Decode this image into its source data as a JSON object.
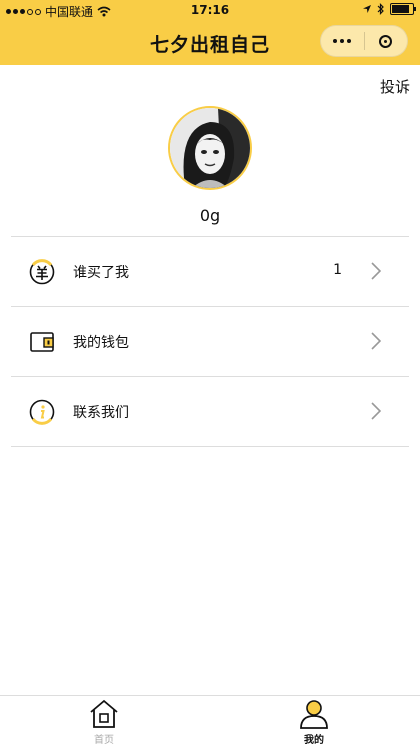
{
  "status_bar": {
    "carrier": "中国联通",
    "time": "17:16",
    "battery_level": 0.9
  },
  "nav": {
    "title": "七夕出租自己"
  },
  "header": {
    "complain_label": "投诉",
    "weight_text": "0g"
  },
  "menu": {
    "items": [
      {
        "label": "谁买了我",
        "count": "1",
        "icon": "yang-coin-icon"
      },
      {
        "label": "我的钱包",
        "count": "",
        "icon": "wallet-icon"
      },
      {
        "label": "联系我们",
        "count": "",
        "icon": "info-icon"
      }
    ]
  },
  "tabbar": {
    "tabs": [
      {
        "label": "首页",
        "icon": "home-icon",
        "active": false
      },
      {
        "label": "我的",
        "icon": "person-icon",
        "active": true
      }
    ]
  },
  "colors": {
    "accent": "#f9cd46",
    "divider": "#dddddd",
    "inactive_tab": "#aaaaaa"
  }
}
